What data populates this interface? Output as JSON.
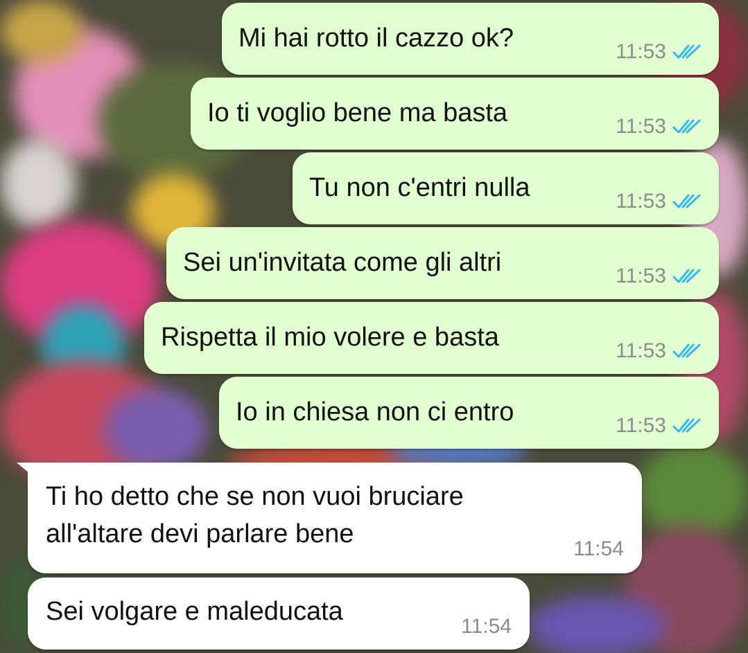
{
  "theme": {
    "outgoing_bubble": "#e2ffd2",
    "incoming_bubble": "#ffffff",
    "read_ticks": "#34b7f1",
    "timestamp": "#8b8b8b"
  },
  "messages": [
    {
      "direction": "out",
      "text": "Mi hai rotto il cazzo ok?",
      "time": "11:53",
      "status_icon": "double-check-read-icon"
    },
    {
      "direction": "out",
      "text": "Io ti voglio bene ma basta",
      "time": "11:53",
      "status_icon": "double-check-read-icon"
    },
    {
      "direction": "out",
      "text": "Tu non c'entri nulla",
      "time": "11:53",
      "status_icon": "double-check-read-icon"
    },
    {
      "direction": "out",
      "text": "Sei un'invitata come gli altri",
      "time": "11:53",
      "status_icon": "double-check-read-icon"
    },
    {
      "direction": "out",
      "text": "Rispetta il mio volere e basta",
      "time": "11:53",
      "status_icon": "double-check-read-icon"
    },
    {
      "direction": "out",
      "text": "Io in chiesa non ci entro",
      "time": "11:53",
      "status_icon": "double-check-read-icon"
    },
    {
      "direction": "in",
      "text": "Ti ho detto che se non vuoi bruciare\nall'altare devi parlare bene",
      "time": "11:54"
    },
    {
      "direction": "in",
      "text": "Sei volgare e maleducata",
      "time": "11:54"
    }
  ]
}
